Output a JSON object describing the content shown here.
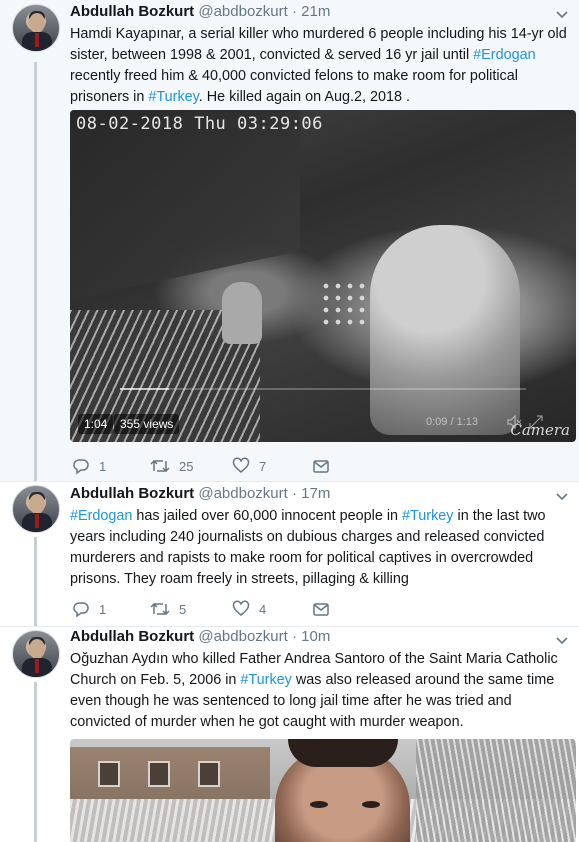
{
  "tweets": [
    {
      "author": {
        "name": "Abdullah Bozkurt",
        "handle": "@abdbozkurt",
        "dot": "·",
        "time": "21m"
      },
      "text_parts": [
        {
          "t": "Hamdi Kayapınar, a serial killer who murdered 6 people including his 14-yr old sister, between 1998 & 2001, convicted & served 16 yr jail until "
        },
        {
          "t": "#Erdogan",
          "tag": true
        },
        {
          "t": " recently freed him & 40,000 convicted felons to make room for political prisoners in "
        },
        {
          "t": "#Turkey",
          "tag": true
        },
        {
          "t": ". He killed again on Aug.2, 2018 ."
        }
      ],
      "video": {
        "timestamp_overlay": "08-02-2018 Thu 03:29:06",
        "camera_label": "Camera",
        "duration": "1:04",
        "views": "355 views",
        "time_position": "0:09 / 1:13",
        "progress": 0.12
      },
      "actions": {
        "replies": "1",
        "retweets": "25",
        "likes": "7"
      }
    },
    {
      "author": {
        "name": "Abdullah Bozkurt",
        "handle": "@abdbozkurt",
        "dot": "·",
        "time": "17m"
      },
      "text_parts": [
        {
          "t": "#Erdogan",
          "tag": true
        },
        {
          "t": " has jailed over 60,000 innocent people in "
        },
        {
          "t": "#Turkey",
          "tag": true
        },
        {
          "t": " in the last two years including 240 journalists on dubious charges and released convicted murderers and rapists to make room for political captives in overcrowded prisons. They roam freely in streets, pillaging & killing"
        }
      ],
      "actions": {
        "replies": "1",
        "retweets": "5",
        "likes": "4"
      }
    },
    {
      "author": {
        "name": "Abdullah Bozkurt",
        "handle": "@abdbozkurt",
        "dot": "·",
        "time": "10m"
      },
      "text_parts": [
        {
          "t": "Oğuzhan Aydın who killed Father Andrea Santoro of the Saint Maria Catholic Church on Feb. 5, 2006 in "
        },
        {
          "t": "#Turkey",
          "tag": true
        },
        {
          "t": " was also released around the same time even though he was sentenced to long jail time after he was tried and convicted of murder when he got caught with murder weapon."
        }
      ]
    }
  ],
  "colors": {
    "link": "#1b95e0",
    "secondary_text": "#657786",
    "thread_line": "#c4cfd6",
    "highlight_bg": "#f5f8fa"
  },
  "icons": [
    "reply-icon",
    "retweet-icon",
    "like-icon",
    "direct-message-icon",
    "chevron-down-icon",
    "mute-icon",
    "expand-icon"
  ]
}
